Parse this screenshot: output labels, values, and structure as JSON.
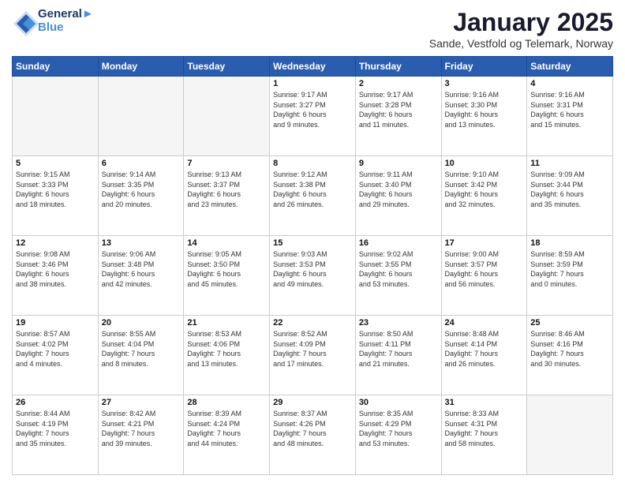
{
  "header": {
    "logo_line1": "General",
    "logo_line2": "Blue",
    "month_title": "January 2025",
    "subtitle": "Sande, Vestfold og Telemark, Norway"
  },
  "weekdays": [
    "Sunday",
    "Monday",
    "Tuesday",
    "Wednesday",
    "Thursday",
    "Friday",
    "Saturday"
  ],
  "weeks": [
    [
      {
        "day": "",
        "info": ""
      },
      {
        "day": "",
        "info": ""
      },
      {
        "day": "",
        "info": ""
      },
      {
        "day": "1",
        "info": "Sunrise: 9:17 AM\nSunset: 3:27 PM\nDaylight: 6 hours\nand 9 minutes."
      },
      {
        "day": "2",
        "info": "Sunrise: 9:17 AM\nSunset: 3:28 PM\nDaylight: 6 hours\nand 11 minutes."
      },
      {
        "day": "3",
        "info": "Sunrise: 9:16 AM\nSunset: 3:30 PM\nDaylight: 6 hours\nand 13 minutes."
      },
      {
        "day": "4",
        "info": "Sunrise: 9:16 AM\nSunset: 3:31 PM\nDaylight: 6 hours\nand 15 minutes."
      }
    ],
    [
      {
        "day": "5",
        "info": "Sunrise: 9:15 AM\nSunset: 3:33 PM\nDaylight: 6 hours\nand 18 minutes."
      },
      {
        "day": "6",
        "info": "Sunrise: 9:14 AM\nSunset: 3:35 PM\nDaylight: 6 hours\nand 20 minutes."
      },
      {
        "day": "7",
        "info": "Sunrise: 9:13 AM\nSunset: 3:37 PM\nDaylight: 6 hours\nand 23 minutes."
      },
      {
        "day": "8",
        "info": "Sunrise: 9:12 AM\nSunset: 3:38 PM\nDaylight: 6 hours\nand 26 minutes."
      },
      {
        "day": "9",
        "info": "Sunrise: 9:11 AM\nSunset: 3:40 PM\nDaylight: 6 hours\nand 29 minutes."
      },
      {
        "day": "10",
        "info": "Sunrise: 9:10 AM\nSunset: 3:42 PM\nDaylight: 6 hours\nand 32 minutes."
      },
      {
        "day": "11",
        "info": "Sunrise: 9:09 AM\nSunset: 3:44 PM\nDaylight: 6 hours\nand 35 minutes."
      }
    ],
    [
      {
        "day": "12",
        "info": "Sunrise: 9:08 AM\nSunset: 3:46 PM\nDaylight: 6 hours\nand 38 minutes."
      },
      {
        "day": "13",
        "info": "Sunrise: 9:06 AM\nSunset: 3:48 PM\nDaylight: 6 hours\nand 42 minutes."
      },
      {
        "day": "14",
        "info": "Sunrise: 9:05 AM\nSunset: 3:50 PM\nDaylight: 6 hours\nand 45 minutes."
      },
      {
        "day": "15",
        "info": "Sunrise: 9:03 AM\nSunset: 3:53 PM\nDaylight: 6 hours\nand 49 minutes."
      },
      {
        "day": "16",
        "info": "Sunrise: 9:02 AM\nSunset: 3:55 PM\nDaylight: 6 hours\nand 53 minutes."
      },
      {
        "day": "17",
        "info": "Sunrise: 9:00 AM\nSunset: 3:57 PM\nDaylight: 6 hours\nand 56 minutes."
      },
      {
        "day": "18",
        "info": "Sunrise: 8:59 AM\nSunset: 3:59 PM\nDaylight: 7 hours\nand 0 minutes."
      }
    ],
    [
      {
        "day": "19",
        "info": "Sunrise: 8:57 AM\nSunset: 4:02 PM\nDaylight: 7 hours\nand 4 minutes."
      },
      {
        "day": "20",
        "info": "Sunrise: 8:55 AM\nSunset: 4:04 PM\nDaylight: 7 hours\nand 8 minutes."
      },
      {
        "day": "21",
        "info": "Sunrise: 8:53 AM\nSunset: 4:06 PM\nDaylight: 7 hours\nand 13 minutes."
      },
      {
        "day": "22",
        "info": "Sunrise: 8:52 AM\nSunset: 4:09 PM\nDaylight: 7 hours\nand 17 minutes."
      },
      {
        "day": "23",
        "info": "Sunrise: 8:50 AM\nSunset: 4:11 PM\nDaylight: 7 hours\nand 21 minutes."
      },
      {
        "day": "24",
        "info": "Sunrise: 8:48 AM\nSunset: 4:14 PM\nDaylight: 7 hours\nand 26 minutes."
      },
      {
        "day": "25",
        "info": "Sunrise: 8:46 AM\nSunset: 4:16 PM\nDaylight: 7 hours\nand 30 minutes."
      }
    ],
    [
      {
        "day": "26",
        "info": "Sunrise: 8:44 AM\nSunset: 4:19 PM\nDaylight: 7 hours\nand 35 minutes."
      },
      {
        "day": "27",
        "info": "Sunrise: 8:42 AM\nSunset: 4:21 PM\nDaylight: 7 hours\nand 39 minutes."
      },
      {
        "day": "28",
        "info": "Sunrise: 8:39 AM\nSunset: 4:24 PM\nDaylight: 7 hours\nand 44 minutes."
      },
      {
        "day": "29",
        "info": "Sunrise: 8:37 AM\nSunset: 4:26 PM\nDaylight: 7 hours\nand 48 minutes."
      },
      {
        "day": "30",
        "info": "Sunrise: 8:35 AM\nSunset: 4:29 PM\nDaylight: 7 hours\nand 53 minutes."
      },
      {
        "day": "31",
        "info": "Sunrise: 8:33 AM\nSunset: 4:31 PM\nDaylight: 7 hours\nand 58 minutes."
      },
      {
        "day": "",
        "info": ""
      }
    ]
  ]
}
